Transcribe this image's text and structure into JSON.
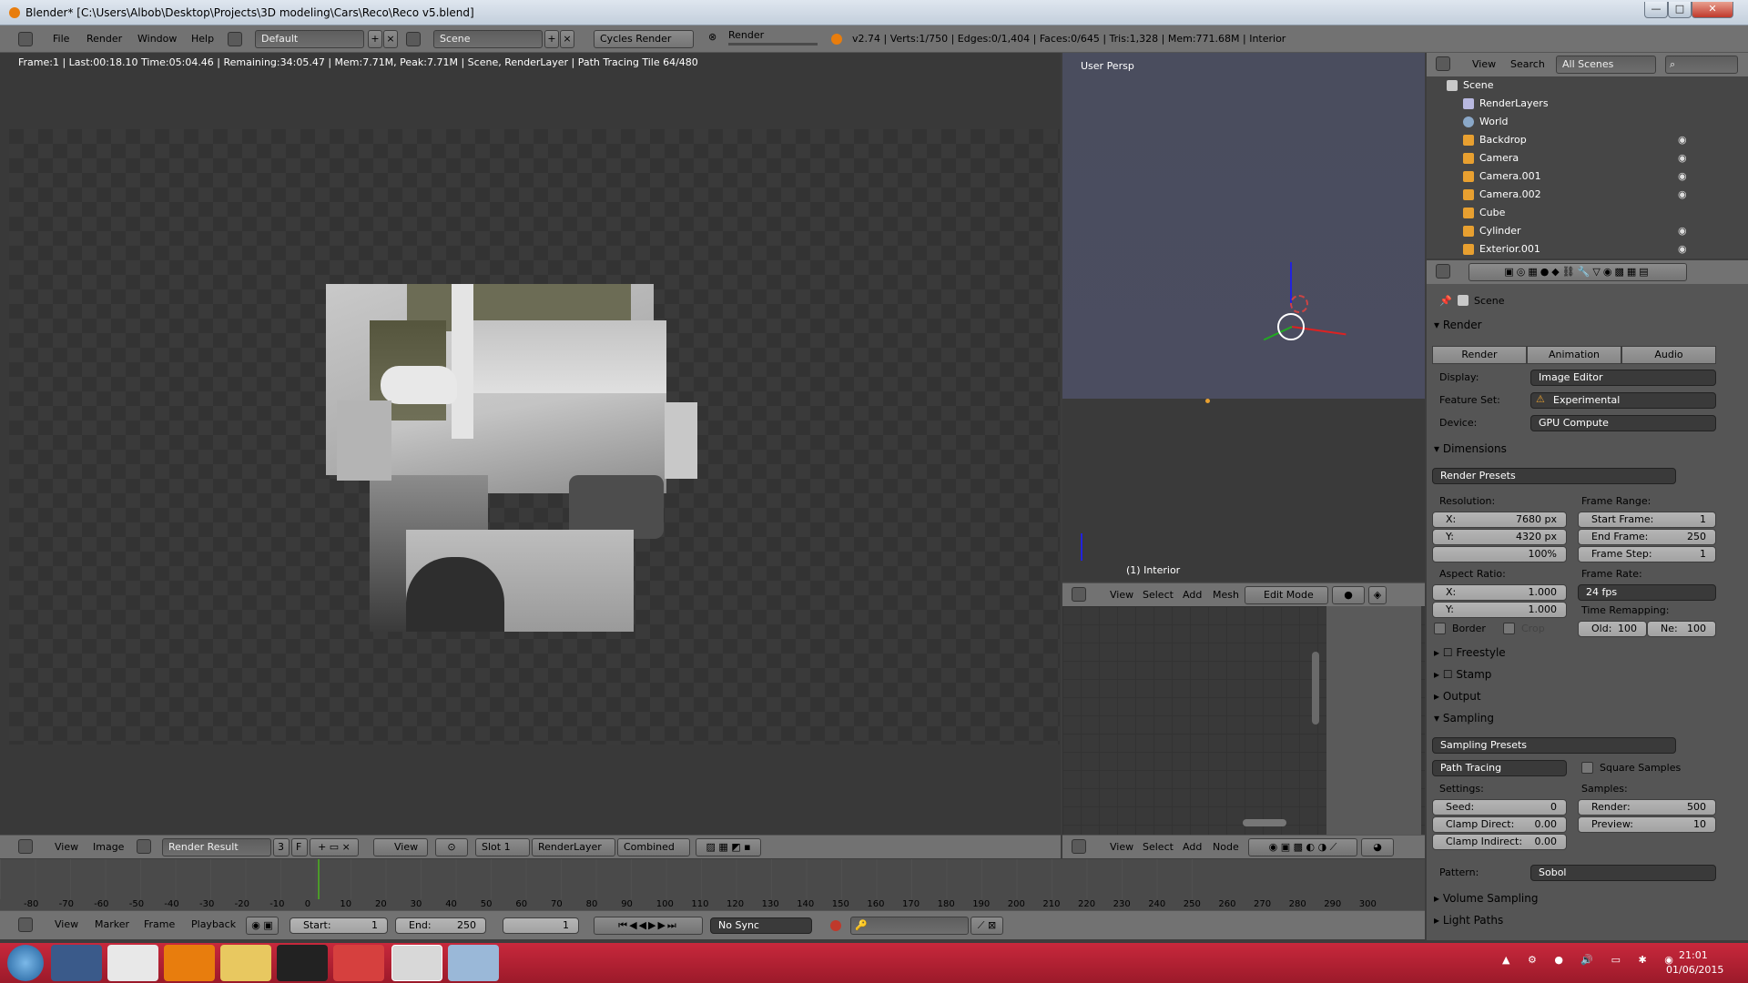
{
  "title_bar": {
    "title": "Blender* [C:\\Users\\Albob\\Desktop\\Projects\\3D modeling\\Cars\\Reco\\Reco v5.blend]",
    "minimize": "—",
    "maximize": "□",
    "close": "✕"
  },
  "info_header": {
    "menus": [
      "File",
      "Render",
      "Window",
      "Help"
    ],
    "screen_layout": "Default",
    "scene": "Scene",
    "engine": "Cycles Render",
    "render_label": "Render",
    "stats": "v2.74 | Verts:1/750 | Edges:0/1,404 | Faces:0/645 | Tris:1,328 | Mem:771.68M | Interior"
  },
  "image_editor": {
    "status": "Frame:1 | Last:00:18.10 Time:05:04.46 | Remaining:34:05.47 | Mem:7.71M, Peak:7.71M | Scene, RenderLayer | Path Tracing Tile 64/480",
    "header": {
      "menus": [
        "View",
        "Image"
      ],
      "image_name": "Render Result",
      "users": "3",
      "fake": "F",
      "view_menu": "View",
      "slot": "Slot 1",
      "layer": "RenderLayer",
      "pass": "Combined"
    }
  },
  "view3d": {
    "label": "User Persp",
    "object_label": "(1) Interior",
    "header": {
      "menus": [
        "View",
        "Select",
        "Add",
        "Mesh"
      ],
      "mode": "Edit Mode"
    }
  },
  "node_editor": {
    "header": {
      "menus": [
        "View",
        "Select",
        "Add",
        "Node"
      ]
    }
  },
  "outliner": {
    "header": {
      "view": "View",
      "search": "Search",
      "display": "All Scenes"
    },
    "items": [
      {
        "label": "Scene",
        "icon": "scene-icon"
      },
      {
        "label": "RenderLayers",
        "icon": "render-layers-icon"
      },
      {
        "label": "World",
        "icon": "world-icon"
      },
      {
        "label": "Backdrop",
        "icon": "mesh-icon"
      },
      {
        "label": "Camera",
        "icon": "camera-icon"
      },
      {
        "label": "Camera.001",
        "icon": "camera-icon"
      },
      {
        "label": "Camera.002",
        "icon": "camera-icon"
      },
      {
        "label": "Cube",
        "icon": "mesh-icon"
      },
      {
        "label": "Cylinder",
        "icon": "mesh-icon"
      },
      {
        "label": "Exterior.001",
        "icon": "mesh-icon"
      }
    ]
  },
  "properties": {
    "context": "Scene",
    "render": {
      "section": "Render",
      "tabs": [
        "Render",
        "Animation",
        "Audio"
      ],
      "display_label": "Display:",
      "display_value": "Image Editor",
      "feature_label": "Feature Set:",
      "feature_value": "Experimental",
      "device_label": "Device:",
      "device_value": "GPU Compute"
    },
    "dimensions": {
      "section": "Dimensions",
      "presets": "Render Presets",
      "resolution_label": "Resolution:",
      "res_x_label": "X:",
      "res_x": "7680 px",
      "res_y_label": "Y:",
      "res_y": "4320 px",
      "res_pct": "100%",
      "frame_range_label": "Frame Range:",
      "start_label": "Start Frame:",
      "start": "1",
      "end_label": "End Frame:",
      "end": "250",
      "step_label": "Frame Step:",
      "step": "1",
      "aspect_label": "Aspect Ratio:",
      "asp_x_label": "X:",
      "asp_x": "1.000",
      "asp_y_label": "Y:",
      "asp_y": "1.000",
      "frame_rate_label": "Frame Rate:",
      "frame_rate": "24 fps",
      "time_remap_label": "Time Remapping:",
      "old_label": "Old:",
      "old": "100",
      "new_label": "Ne:",
      "new": "100",
      "border_label": "Border",
      "crop_label": "Crop"
    },
    "collapsed_sections": [
      "Freestyle",
      "Stamp",
      "Output"
    ],
    "sampling": {
      "section": "Sampling",
      "presets": "Sampling Presets",
      "integrator": "Path Tracing",
      "square_label": "Square Samples",
      "settings_label": "Settings:",
      "seed_label": "Seed:",
      "seed": "0",
      "clamp_direct_label": "Clamp Direct:",
      "clamp_direct": "0.00",
      "clamp_indirect_label": "Clamp Indirect:",
      "clamp_indirect": "0.00",
      "samples_label": "Samples:",
      "render_label": "Render:",
      "render": "500",
      "preview_label": "Preview:",
      "preview": "10",
      "pattern_label": "Pattern:",
      "pattern": "Sobol"
    },
    "bottom_sections": [
      "Volume Sampling",
      "Light Paths"
    ]
  },
  "timeline": {
    "ticks": [
      "-80",
      "-70",
      "-60",
      "-50",
      "-40",
      "-30",
      "-20",
      "-10",
      "0",
      "10",
      "20",
      "30",
      "40",
      "50",
      "60",
      "70",
      "80",
      "90",
      "100",
      "110",
      "120",
      "130",
      "140",
      "150",
      "160",
      "170",
      "180",
      "190",
      "200",
      "210",
      "220",
      "230",
      "240",
      "250",
      "260",
      "270",
      "280",
      "290",
      "300"
    ],
    "header": {
      "menus": [
        "View",
        "Marker",
        "Frame",
        "Playback"
      ],
      "start_label": "Start:",
      "start": "1",
      "end_label": "End:",
      "end": "250",
      "current": "1",
      "sync": "No Sync"
    }
  },
  "taskbar": {
    "time": "21:01",
    "date": "01/06/2015"
  },
  "colors": {
    "accent": "#e87d0d",
    "taskbar": "#b21f32",
    "panel": "#555555",
    "header": "#727272"
  }
}
